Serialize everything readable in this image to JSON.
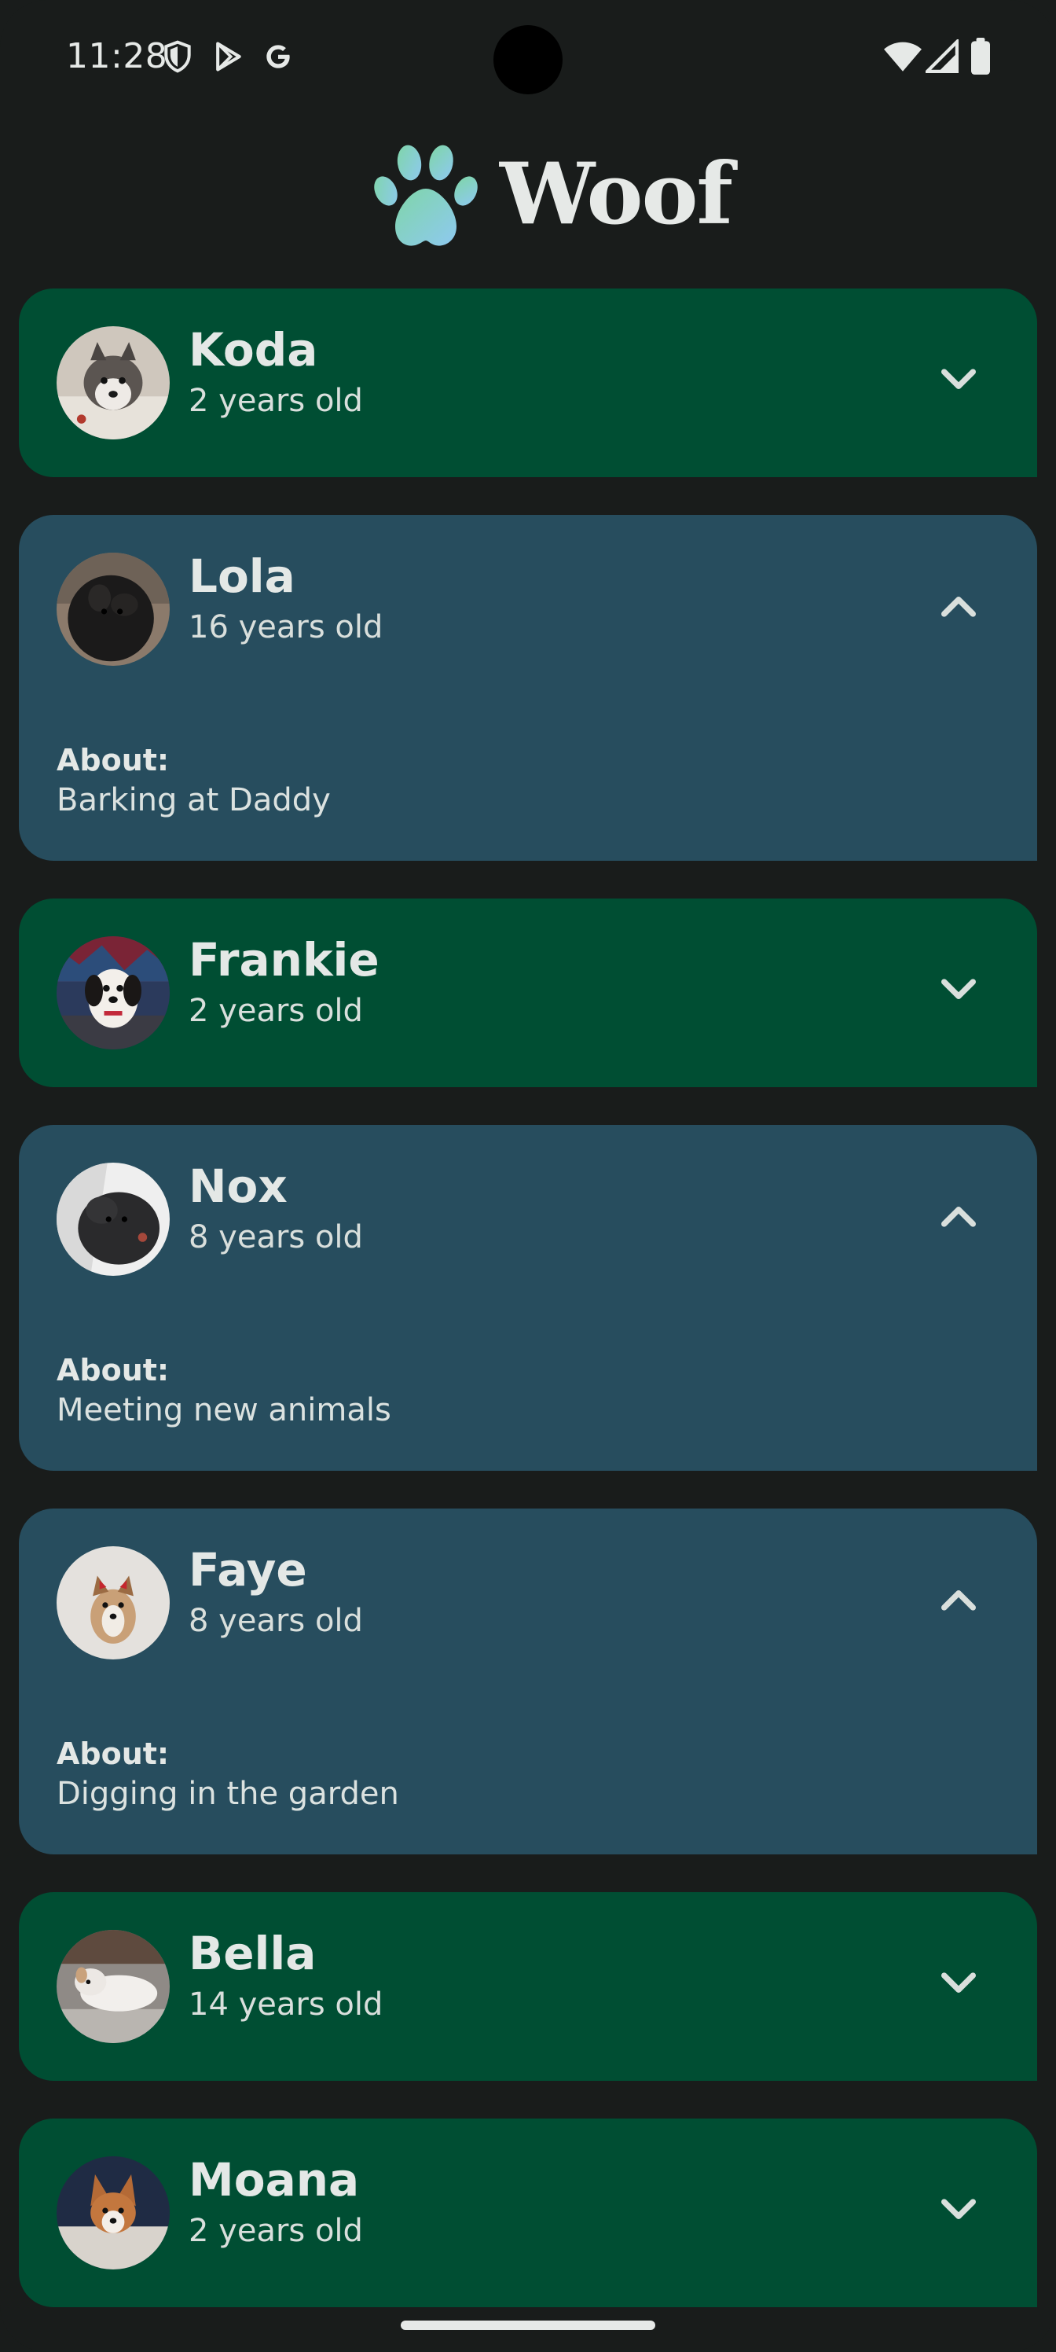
{
  "status_bar": {
    "time": "11:28",
    "left_icons": [
      "shield-icon",
      "play-store-icon",
      "google-icon"
    ],
    "right_icons": [
      "wifi-icon",
      "signal-icon",
      "battery-icon"
    ]
  },
  "app": {
    "title": "Woof",
    "logo_icon": "paw-icon"
  },
  "colors": {
    "background": "#191c1b",
    "card_collapsed": "#004e33",
    "card_expanded": "#274d5e",
    "text": "#e4e8e6"
  },
  "dogs": [
    {
      "name": "Koda",
      "age": "2 years old",
      "expanded": false
    },
    {
      "name": "Lola",
      "age": "16 years old",
      "expanded": true,
      "about_label": "About:",
      "about": "Barking at Daddy"
    },
    {
      "name": "Frankie",
      "age": "2 years old",
      "expanded": false
    },
    {
      "name": "Nox",
      "age": "8 years old",
      "expanded": true,
      "about_label": "About:",
      "about": "Meeting new animals"
    },
    {
      "name": "Faye",
      "age": "8 years old",
      "expanded": true,
      "about_label": "About:",
      "about": "Digging in the garden"
    },
    {
      "name": "Bella",
      "age": "14 years old",
      "expanded": false
    },
    {
      "name": "Moana",
      "age": "2 years old",
      "expanded": false
    }
  ]
}
